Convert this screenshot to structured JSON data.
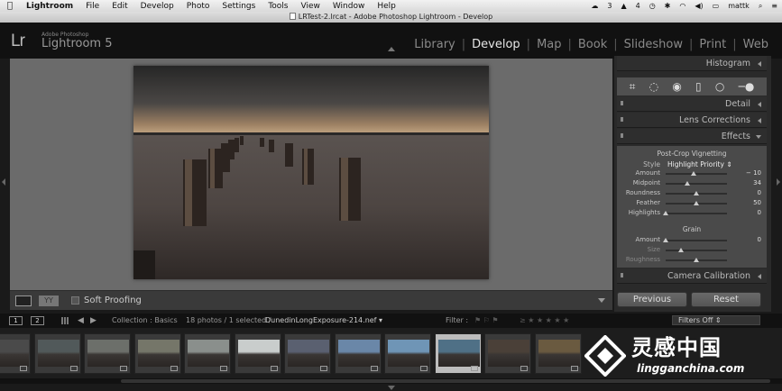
{
  "menubar": {
    "items": [
      "Lightroom",
      "File",
      "Edit",
      "Develop",
      "Photo",
      "Settings",
      "Tools",
      "View",
      "Window",
      "Help"
    ],
    "status": [
      "3",
      "4",
      "mattk"
    ]
  },
  "window": {
    "title": "LRTest-2.lrcat - Adobe Photoshop Lightroom - Develop"
  },
  "identity": {
    "logo": "Lr",
    "small": "Adobe Photoshop",
    "name": "Lightroom 5"
  },
  "modules": [
    "Library",
    "Develop",
    "Map",
    "Book",
    "Slideshow",
    "Print",
    "Web"
  ],
  "modules_active": "Develop",
  "toolbar": {
    "view_label": "YY",
    "soft_proofing": "Soft Proofing"
  },
  "panel": {
    "histogram": "Histogram",
    "detail": "Detail",
    "lens": "Lens Corrections",
    "effects": "Effects",
    "vignette_title": "Post-Crop Vignetting",
    "style_label": "Style",
    "style_value": "Highlight Priority",
    "vignette_sliders": [
      {
        "label": "Amount",
        "value": "− 10",
        "pos": 0.45
      },
      {
        "label": "Midpoint",
        "value": "34",
        "pos": 0.36
      },
      {
        "label": "Roundness",
        "value": "0",
        "pos": 0.5
      },
      {
        "label": "Feather",
        "value": "50",
        "pos": 0.5
      },
      {
        "label": "Highlights",
        "value": "0",
        "pos": 0.0
      }
    ],
    "grain_title": "Grain",
    "grain_sliders": [
      {
        "label": "Amount",
        "value": "0",
        "pos": 0.0
      },
      {
        "label": "Size",
        "value": "",
        "pos": 0.25
      },
      {
        "label": "Roughness",
        "value": "",
        "pos": 0.5
      }
    ],
    "camera": "Camera Calibration",
    "previous": "Previous",
    "reset": "Reset"
  },
  "filmstrip_bar": {
    "screen1": "1",
    "screen2": "2",
    "collection": "Collection : Basics",
    "count": "18 photos / 1 selected /",
    "filename": "DunedinLongExposure-214.nef",
    "filter_label": "Filter :",
    "filters_off": "Filters Off"
  },
  "thumbnails": [
    "#4a4a4a",
    "#51595a",
    "#6c6f6a",
    "#757669",
    "#8a8f8c",
    "#c9cdcc",
    "#5a6070",
    "#6a87a8",
    "#6f95b6",
    "#4f7086",
    "#4a4038",
    "#6a5a40"
  ],
  "selected_thumbnail": 9,
  "watermark": {
    "cn": "灵感中国",
    "en": "lingganchina.com"
  }
}
